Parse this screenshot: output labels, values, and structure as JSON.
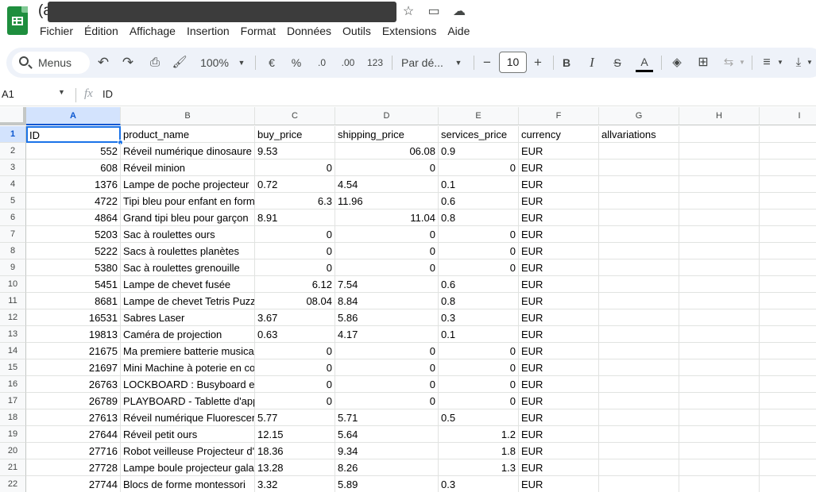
{
  "document": {
    "title_prefix": "(a"
  },
  "menu": [
    "Fichier",
    "Édition",
    "Affichage",
    "Insertion",
    "Format",
    "Données",
    "Outils",
    "Extensions",
    "Aide"
  ],
  "toolbar": {
    "search_label": "Menus",
    "zoom": "100%",
    "currency": "€",
    "percent": "%",
    "dec_decrease": ".0",
    "dec_increase": ".00",
    "number_format": "123",
    "font_family": "Par dé...",
    "minus": "−",
    "font_size": "10",
    "plus": "+",
    "bold": "B",
    "italic": "I",
    "strike": "S",
    "text_color": "A"
  },
  "formula_bar": {
    "cell_ref": "A1",
    "fx": "fx",
    "value": "ID"
  },
  "columns": [
    "A",
    "B",
    "C",
    "D",
    "E",
    "F",
    "G",
    "H",
    "I"
  ],
  "sheet": {
    "header_row": [
      "ID",
      "product_name",
      "buy_price",
      "shipping_price",
      "services_price",
      "currency",
      "allvariations"
    ],
    "rows": [
      {
        "n": "2",
        "id": "552",
        "name": "Réveil numérique dinosaure",
        "buy": "9.53",
        "buy_num": false,
        "ship": "06.08",
        "ship_num": true,
        "serv": "0.9",
        "serv_num": false,
        "cur": "EUR"
      },
      {
        "n": "3",
        "id": "608",
        "name": "Réveil minion",
        "buy": "0",
        "buy_num": true,
        "ship": "0",
        "ship_num": true,
        "serv": "0",
        "serv_num": true,
        "cur": "EUR"
      },
      {
        "n": "4",
        "id": "1376",
        "name": "Lampe de poche projecteur",
        "buy": "0.72",
        "buy_num": false,
        "ship": "4.54",
        "ship_num": false,
        "serv": "0.1",
        "serv_num": false,
        "cur": "EUR"
      },
      {
        "n": "5",
        "id": "4722",
        "name": "Tipi bleu pour enfant en form",
        "buy": "6.3",
        "buy_num": true,
        "ship": "11.96",
        "ship_num": false,
        "serv": "0.6",
        "serv_num": false,
        "cur": "EUR"
      },
      {
        "n": "6",
        "id": "4864",
        "name": "Grand tipi bleu pour garçon",
        "buy": "8.91",
        "buy_num": false,
        "ship": "11.04",
        "ship_num": true,
        "serv": "0.8",
        "serv_num": false,
        "cur": "EUR"
      },
      {
        "n": "7",
        "id": "5203",
        "name": "Sac à roulettes ours",
        "buy": "0",
        "buy_num": true,
        "ship": "0",
        "ship_num": true,
        "serv": "0",
        "serv_num": true,
        "cur": "EUR"
      },
      {
        "n": "8",
        "id": "5222",
        "name": "Sacs à roulettes planètes",
        "buy": "0",
        "buy_num": true,
        "ship": "0",
        "ship_num": true,
        "serv": "0",
        "serv_num": true,
        "cur": "EUR"
      },
      {
        "n": "9",
        "id": "5380",
        "name": "Sac à roulettes grenouille",
        "buy": "0",
        "buy_num": true,
        "ship": "0",
        "ship_num": true,
        "serv": "0",
        "serv_num": true,
        "cur": "EUR"
      },
      {
        "n": "10",
        "id": "5451",
        "name": "Lampe de chevet fusée",
        "buy": "6.12",
        "buy_num": true,
        "ship": "7.54",
        "ship_num": false,
        "serv": "0.6",
        "serv_num": false,
        "cur": "EUR"
      },
      {
        "n": "11",
        "id": "8681",
        "name": "Lampe de chevet Tetris Puzzle",
        "buy": "08.04",
        "buy_num": true,
        "ship": "8.84",
        "ship_num": false,
        "serv": "0.8",
        "serv_num": false,
        "cur": "EUR"
      },
      {
        "n": "12",
        "id": "16531",
        "name": "Sabres Laser",
        "buy": "3.67",
        "buy_num": false,
        "ship": "5.86",
        "ship_num": false,
        "serv": "0.3",
        "serv_num": false,
        "cur": "EUR"
      },
      {
        "n": "13",
        "id": "19813",
        "name": "Caméra de projection",
        "buy": "0.63",
        "buy_num": false,
        "ship": "4.17",
        "ship_num": false,
        "serv": "0.1",
        "serv_num": false,
        "cur": "EUR"
      },
      {
        "n": "14",
        "id": "21675",
        "name": "Ma premiere batterie musicale",
        "buy": "0",
        "buy_num": true,
        "ship": "0",
        "ship_num": true,
        "serv": "0",
        "serv_num": true,
        "cur": "EUR"
      },
      {
        "n": "15",
        "id": "21697",
        "name": "Mini Machine à poterie en coffret",
        "buy": "0",
        "buy_num": true,
        "ship": "0",
        "ship_num": true,
        "serv": "0",
        "serv_num": true,
        "cur": "EUR"
      },
      {
        "n": "16",
        "id": "26763",
        "name": "LOCKBOARD : Busyboard en bois",
        "buy": "0",
        "buy_num": true,
        "ship": "0",
        "ship_num": true,
        "serv": "0",
        "serv_num": true,
        "cur": "EUR"
      },
      {
        "n": "17",
        "id": "26789",
        "name": "PLAYBOARD - Tablette d'apprentissage",
        "buy": "0",
        "buy_num": true,
        "ship": "0",
        "ship_num": true,
        "serv": "0",
        "serv_num": true,
        "cur": "EUR"
      },
      {
        "n": "18",
        "id": "27613",
        "name": "Réveil numérique Fluorescent",
        "buy": "5.77",
        "buy_num": false,
        "ship": "5.71",
        "ship_num": false,
        "serv": "0.5",
        "serv_num": false,
        "cur": "EUR"
      },
      {
        "n": "19",
        "id": "27644",
        "name": "Réveil petit ours",
        "buy": "12.15",
        "buy_num": false,
        "ship": "5.64",
        "ship_num": false,
        "serv": "1.2",
        "serv_num": true,
        "cur": "EUR"
      },
      {
        "n": "20",
        "id": "27716",
        "name": "Robot veilleuse Projecteur d'étoiles",
        "buy": "18.36",
        "buy_num": false,
        "ship": "9.34",
        "ship_num": false,
        "serv": "1.8",
        "serv_num": true,
        "cur": "EUR"
      },
      {
        "n": "21",
        "id": "27728",
        "name": "Lampe boule projecteur galaxie",
        "buy": "13.28",
        "buy_num": false,
        "ship": "8.26",
        "ship_num": false,
        "serv": "1.3",
        "serv_num": true,
        "cur": "EUR"
      },
      {
        "n": "22",
        "id": "27744",
        "name": "Blocs de forme montessori",
        "buy": "3.32",
        "buy_num": false,
        "ship": "5.89",
        "ship_num": false,
        "serv": "0.3",
        "serv_num": false,
        "cur": "EUR"
      }
    ]
  }
}
